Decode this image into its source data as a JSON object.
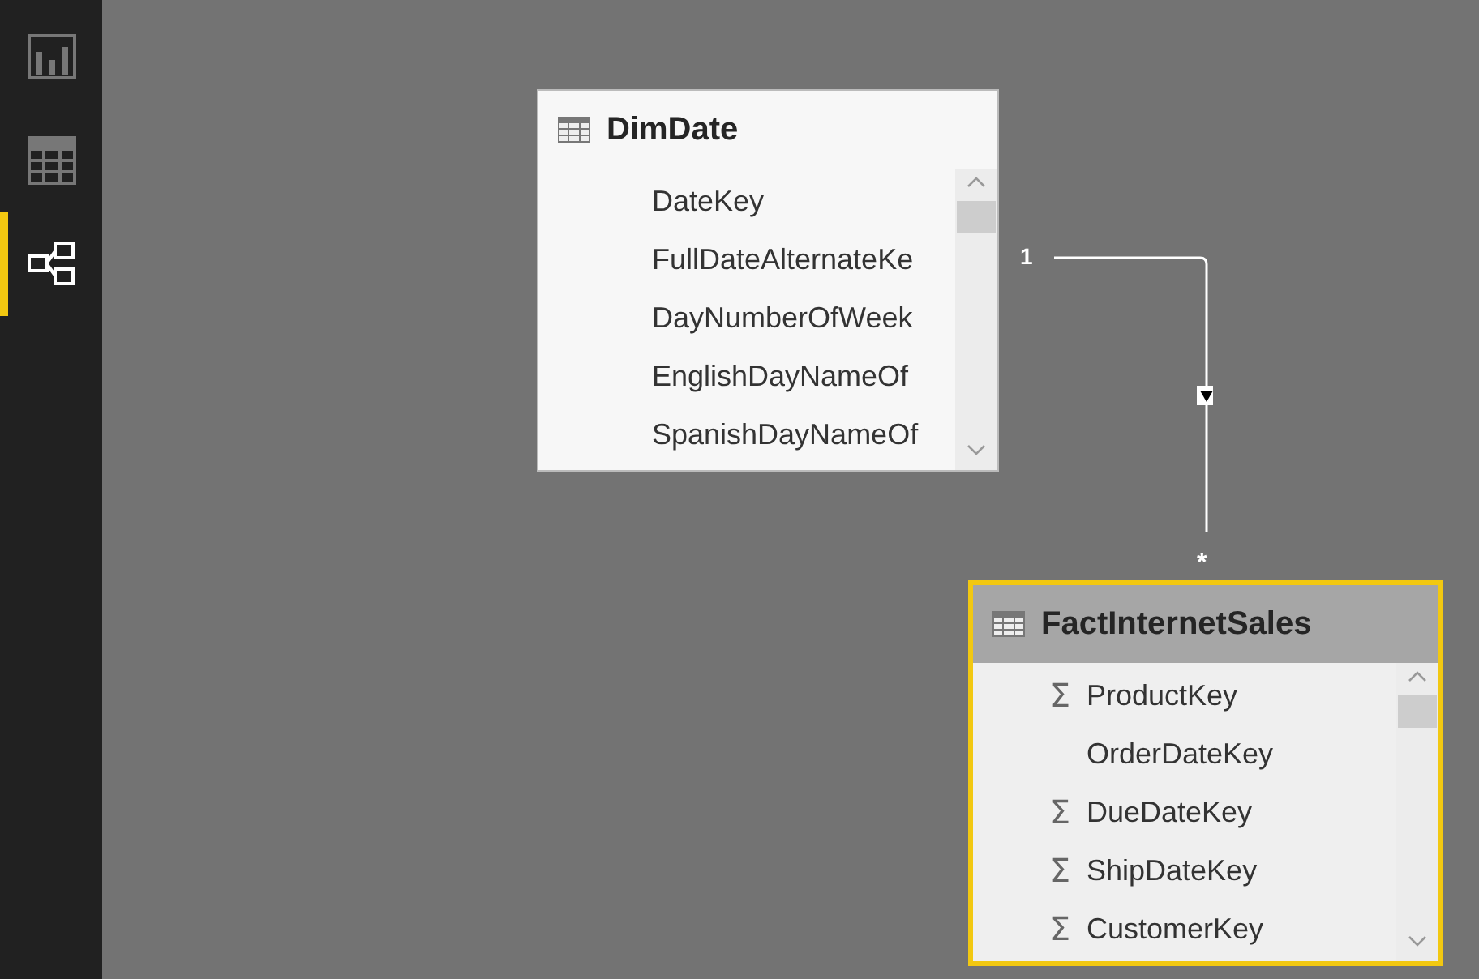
{
  "sidebar": {
    "items": [
      {
        "kind": "report",
        "selected": false
      },
      {
        "kind": "data",
        "selected": false
      },
      {
        "kind": "relationships",
        "selected": true
      }
    ]
  },
  "tables": [
    {
      "name": "DimDate",
      "selected": false,
      "fields": [
        {
          "name": "DateKey",
          "kind": "plain"
        },
        {
          "name": "FullDateAlternateKe",
          "kind": "plain"
        },
        {
          "name": "DayNumberOfWeek",
          "kind": "plain"
        },
        {
          "name": "EnglishDayNameOf",
          "kind": "plain"
        },
        {
          "name": "SpanishDayNameOf",
          "kind": "plain"
        }
      ]
    },
    {
      "name": "FactInternetSales",
      "selected": true,
      "fields": [
        {
          "name": "ProductKey",
          "kind": "sum",
          "symbol": "Σ"
        },
        {
          "name": "OrderDateKey",
          "kind": "plain"
        },
        {
          "name": "DueDateKey",
          "kind": "sum",
          "symbol": "Σ"
        },
        {
          "name": "ShipDateKey",
          "kind": "sum",
          "symbol": "Σ"
        },
        {
          "name": "CustomerKey",
          "kind": "sum",
          "symbol": "Σ"
        }
      ]
    }
  ],
  "relationship": {
    "from_cardinality": "1",
    "to_cardinality": "*"
  }
}
